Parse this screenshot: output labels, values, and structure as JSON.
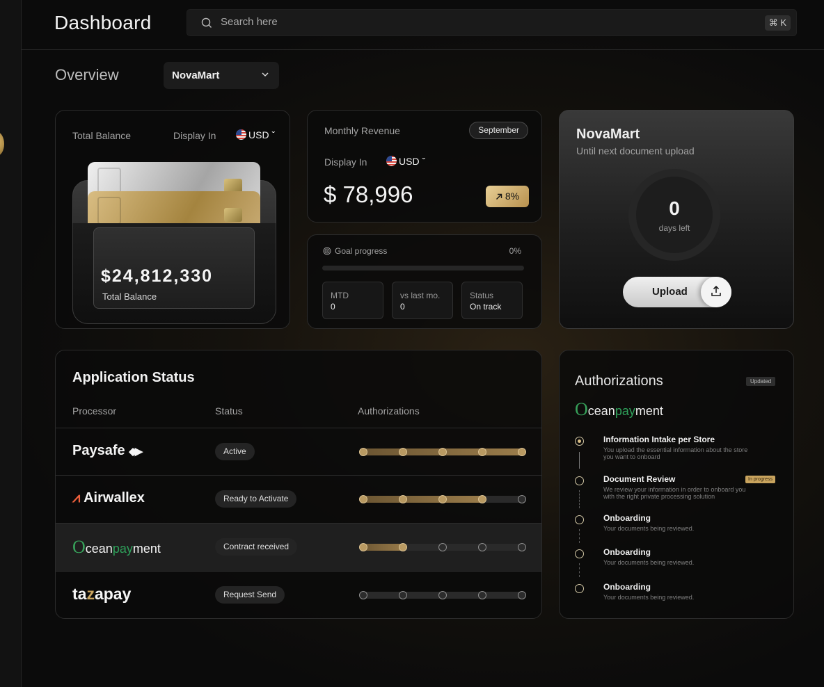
{
  "header": {
    "title": "Dashboard",
    "search_placeholder": "Search here",
    "shortcut": "⌘ K"
  },
  "overview": {
    "title": "Overview",
    "store": "NovaMart"
  },
  "balance": {
    "label": "Total Balance",
    "display_in": "Display In",
    "currency": "USD",
    "amount": "$24,812,330",
    "card_label": "Total Balance"
  },
  "revenue": {
    "title": "Monthly Revenue",
    "month": "September",
    "display_in": "Display In",
    "currency": "USD",
    "amount": "$ 78,996",
    "growth": "8%"
  },
  "goal": {
    "label": "Goal progress",
    "percent_text": "0%",
    "progress": 0,
    "stats": [
      {
        "label": "MTD",
        "value": "0"
      },
      {
        "label": "vs last mo.",
        "value": "0"
      },
      {
        "label": "Status",
        "value": "On track"
      }
    ]
  },
  "upload": {
    "store": "NovaMart",
    "subtitle": "Until next document upload",
    "days": "0",
    "days_label": "days left",
    "button": "Upload"
  },
  "app_status": {
    "title": "Application Status",
    "columns": [
      "Processor",
      "Status",
      "Authorizations"
    ],
    "rows": [
      {
        "processor": "Paysafe",
        "status": "Active",
        "completed": 5,
        "total": 5
      },
      {
        "processor": "Airwallex",
        "status": "Ready to Activate",
        "completed": 4,
        "total": 5
      },
      {
        "processor": "Oceanpayment",
        "status": "Contract received",
        "completed": 2,
        "total": 5
      },
      {
        "processor": "tazapay",
        "status": "Request Send",
        "completed": 0,
        "total": 5
      }
    ]
  },
  "authorizations": {
    "title": "Authorizations",
    "badge": "Updated",
    "processor_logo": "Oceanpayment",
    "in_progress": "In progress",
    "steps": [
      {
        "title": "Information Intake per Store",
        "desc": "You upload the essential information about the store you want to onboard",
        "state": "done"
      },
      {
        "title": "Document Review",
        "desc": "We review your information in order to onboard you with the right private processing solution",
        "state": "in-progress"
      },
      {
        "title": "Onboarding",
        "desc": "Your documents being reviewed.",
        "state": "pending"
      },
      {
        "title": "Onboarding",
        "desc": "Your documents being reviewed.",
        "state": "pending"
      },
      {
        "title": "Onboarding",
        "desc": "Your documents being reviewed.",
        "state": "pending"
      }
    ]
  },
  "colors": {
    "accent_gold": "#c9a45e",
    "background": "#0b0b0b",
    "logo_green": "#37a15a",
    "airwallex_orange": "#f0603c"
  },
  "icons": [
    "search-icon",
    "chevron-down-icon",
    "us-flag-icon",
    "arrow-up-right-icon",
    "target-icon",
    "upload-icon"
  ]
}
